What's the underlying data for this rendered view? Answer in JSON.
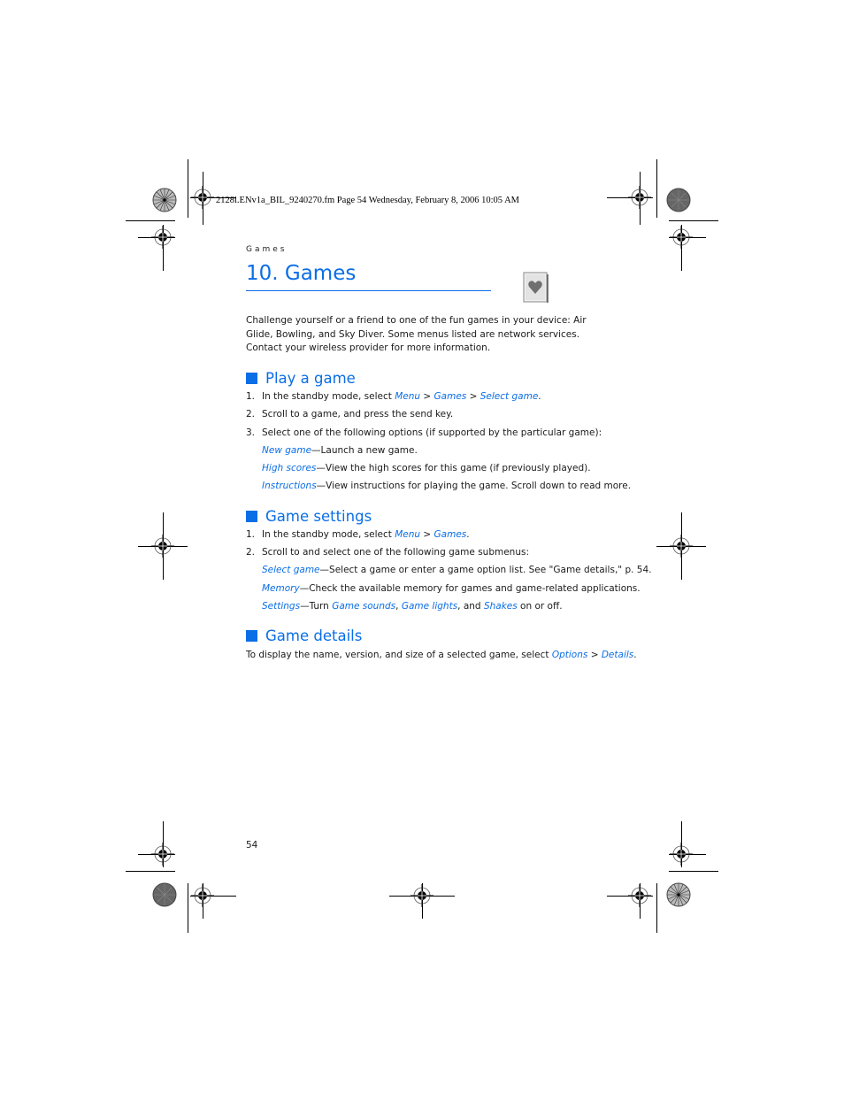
{
  "slug": "2128i.ENv1a_BIL_9240270.fm  Page 54  Wednesday, February 8, 2006  10:05 AM",
  "running_head": "Games",
  "chapter": {
    "title": "10. Games",
    "icon": "playing-card-heart-icon"
  },
  "intro": "Challenge yourself or a friend to one of the fun games in your device: Air Glide, Bowling, and Sky Diver. Some menus listed are network services. Contact your wireless provider for more information.",
  "sections": {
    "play": {
      "heading": "Play a game",
      "steps": [
        {
          "num": "1.",
          "pre": "In the standby mode, select ",
          "l1": "Menu",
          "sep1": " > ",
          "l2": "Games",
          "sep2": " > ",
          "l3": "Select game",
          "post": "."
        },
        {
          "num": "2.",
          "text": "Scroll to a game, and press the send key."
        },
        {
          "num": "3.",
          "text": "Select one of the following options (if supported by the particular game):"
        }
      ],
      "options": [
        {
          "term": "New game",
          "desc": "—Launch a new game."
        },
        {
          "term": "High scores",
          "desc": "—View the high scores for this game (if previously played)."
        },
        {
          "term": "Instructions",
          "desc": "—View instructions for playing the game. Scroll down to read more."
        }
      ]
    },
    "settings": {
      "heading": "Game settings",
      "steps": [
        {
          "num": "1.",
          "pre": "In the standby mode, select ",
          "l1": "Menu",
          "sep1": " > ",
          "l2": "Games",
          "post": "."
        },
        {
          "num": "2.",
          "text": "Scroll to and select one of the following game submenus:"
        }
      ],
      "options": [
        {
          "term": "Select game",
          "desc": "—Select a game or enter a game option list. See \"Game details,\" p. 54."
        },
        {
          "term": "Memory",
          "desc": "—Check the available memory for games and game-related applications."
        },
        {
          "term": "Settings",
          "desc": "—Turn ",
          "l1": "Game sounds",
          "m1": ", ",
          "l2": "Game lights",
          "m2": ", and ",
          "l3": "Shakes",
          "post": " on or off."
        }
      ]
    },
    "details": {
      "heading": "Game details",
      "pre": "To display the name, version, and size of a selected game, select ",
      "l1": "Options",
      "sep": " > ",
      "l2": "Details",
      "post": "."
    }
  },
  "page_number": "54"
}
